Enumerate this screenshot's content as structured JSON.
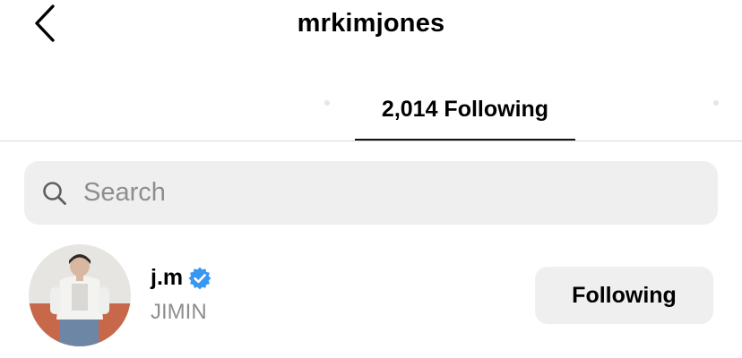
{
  "header": {
    "title": "mrkimjones",
    "back_icon": "chevron-left-icon"
  },
  "tabs": {
    "active_label": "2,014 Following"
  },
  "search": {
    "placeholder": "Search",
    "icon": "search-icon"
  },
  "users": [
    {
      "username": "j.m",
      "full_name": "JIMIN",
      "verified": true,
      "follow_button_label": "Following"
    }
  ],
  "colors": {
    "verified_badge": "#3897f0",
    "secondary_text": "#8e8e8e",
    "field_background": "#efefef"
  }
}
